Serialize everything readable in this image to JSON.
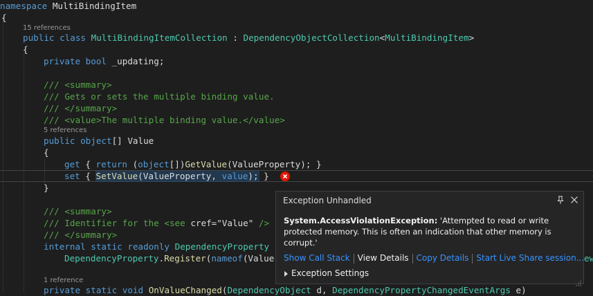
{
  "code": {
    "line1": {
      "kw": "namespace",
      "name": " MultiBindingItem"
    },
    "line2": "{",
    "lens1": "15 references",
    "line3": {
      "kw1": "public",
      "kw2": "class",
      "name": "MultiBindingItemCollection",
      "colon": " : ",
      "base": "DependencyObjectCollection",
      "lt": "<",
      "arg": "MultiBindingItem",
      "gt": ">"
    },
    "line4": "{",
    "line5": {
      "kw1": "private",
      "kw2": "bool",
      "rest": " _updating;"
    },
    "line6": "/// <summary>",
    "line7": "/// Gets or sets the multiple binding value.",
    "line8": "/// </summary>",
    "line9": "/// <value>The multiple binding value.</value>",
    "lens2": "5 references",
    "line10": {
      "kw1": "public",
      "kw2": "object",
      "rest": "[] Value"
    },
    "line11": "{",
    "line12": {
      "kw1": "get",
      "p1": " { ",
      "kw2": "return",
      "p2": " (",
      "kw3": "object",
      "p3": "[])",
      "m": "GetValue",
      "p4": "(ValueProperty); }"
    },
    "line13": {
      "kw1": "set",
      "p1": " { ",
      "m": "SetValue",
      "p2": "(ValueProperty, ",
      "kw2": "value",
      "p3": ");",
      "p4": " }"
    },
    "line14": "}",
    "line15": "/// <summary>",
    "line16": {
      "c1": "/// Identifier for the ",
      "k": "<see",
      "c2": " cref=\"Value\"",
      "c3": " />"
    },
    "line17": "/// </summary>",
    "line18": {
      "kw1": "internal",
      "kw2": "static",
      "kw3": "readonly",
      "ty": "DependencyProperty"
    },
    "line19": {
      "ty": "DependencyProperty",
      "dot": ".",
      "m": "Register",
      "p1": "(",
      "kw": "nameof",
      "p2": "(Value"
    },
    "lens3": "1 reference",
    "line20": {
      "kw1": "private",
      "kw2": "static",
      "kw3": "void",
      "m": "OnValueChanged",
      "p1": "(",
      "ty1": "DependencyObject",
      "p2": " d, ",
      "ty2": "DependencyPropertyChangedEventArgs",
      "p3": " e)"
    },
    "overflow": "ew"
  },
  "popup": {
    "title": "Exception Unhandled",
    "exception_type": "System.AccessViolationException:",
    "message": " 'Attempted to read or write protected memory. This is often an indication that other memory is corrupt.'",
    "links": {
      "call_stack": "Show Call Stack",
      "view_details": "View Details",
      "copy_details": "Copy Details",
      "live_share": "Start Live Share session..."
    },
    "settings": "Exception Settings"
  },
  "colors": {
    "background": "#1e1e1e",
    "keyword": "#569cd6",
    "type": "#4ec9b0",
    "comment": "#57a64a",
    "link": "#3794ff",
    "error": "#e51400"
  }
}
